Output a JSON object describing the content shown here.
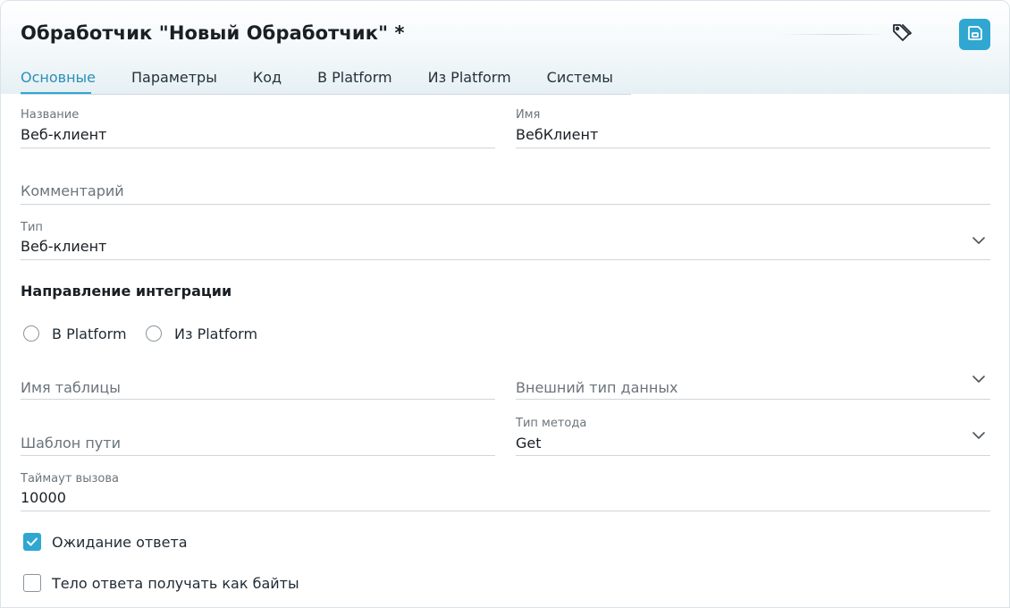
{
  "header": {
    "title": "Обработчик \"Новый Обработчик\" *",
    "tag_icon": "tag-icon",
    "save_icon": "save-icon",
    "accent_color": "#2fa7d1"
  },
  "tabs": [
    {
      "label": "Основные",
      "active": true
    },
    {
      "label": "Параметры"
    },
    {
      "label": "Код"
    },
    {
      "label": "В Platform"
    },
    {
      "label": "Из Platform"
    },
    {
      "label": "Системы"
    }
  ],
  "form": {
    "name": {
      "label": "Название",
      "value": "Веб-клиент"
    },
    "id_name": {
      "label": "Имя",
      "value": "ВебКлиент"
    },
    "comment": {
      "placeholder": "Комментарий"
    },
    "type": {
      "label": "Тип",
      "value": "Веб-клиент"
    },
    "direction": {
      "title": "Направление интеграции",
      "options": [
        "В Platform",
        "Из Platform"
      ]
    },
    "table_name": {
      "placeholder": "Имя таблицы"
    },
    "external_type": {
      "placeholder": "Внешний тип данных"
    },
    "path_template": {
      "placeholder": "Шаблон пути"
    },
    "method_type": {
      "label": "Тип метода",
      "value": "Get"
    },
    "timeout": {
      "label": "Таймаут вызова",
      "value": "10000"
    },
    "wait_response": {
      "label": "Ожидание ответа",
      "checked": true
    },
    "body_as_bytes": {
      "label": "Тело ответа получать как байты",
      "checked": false
    }
  }
}
